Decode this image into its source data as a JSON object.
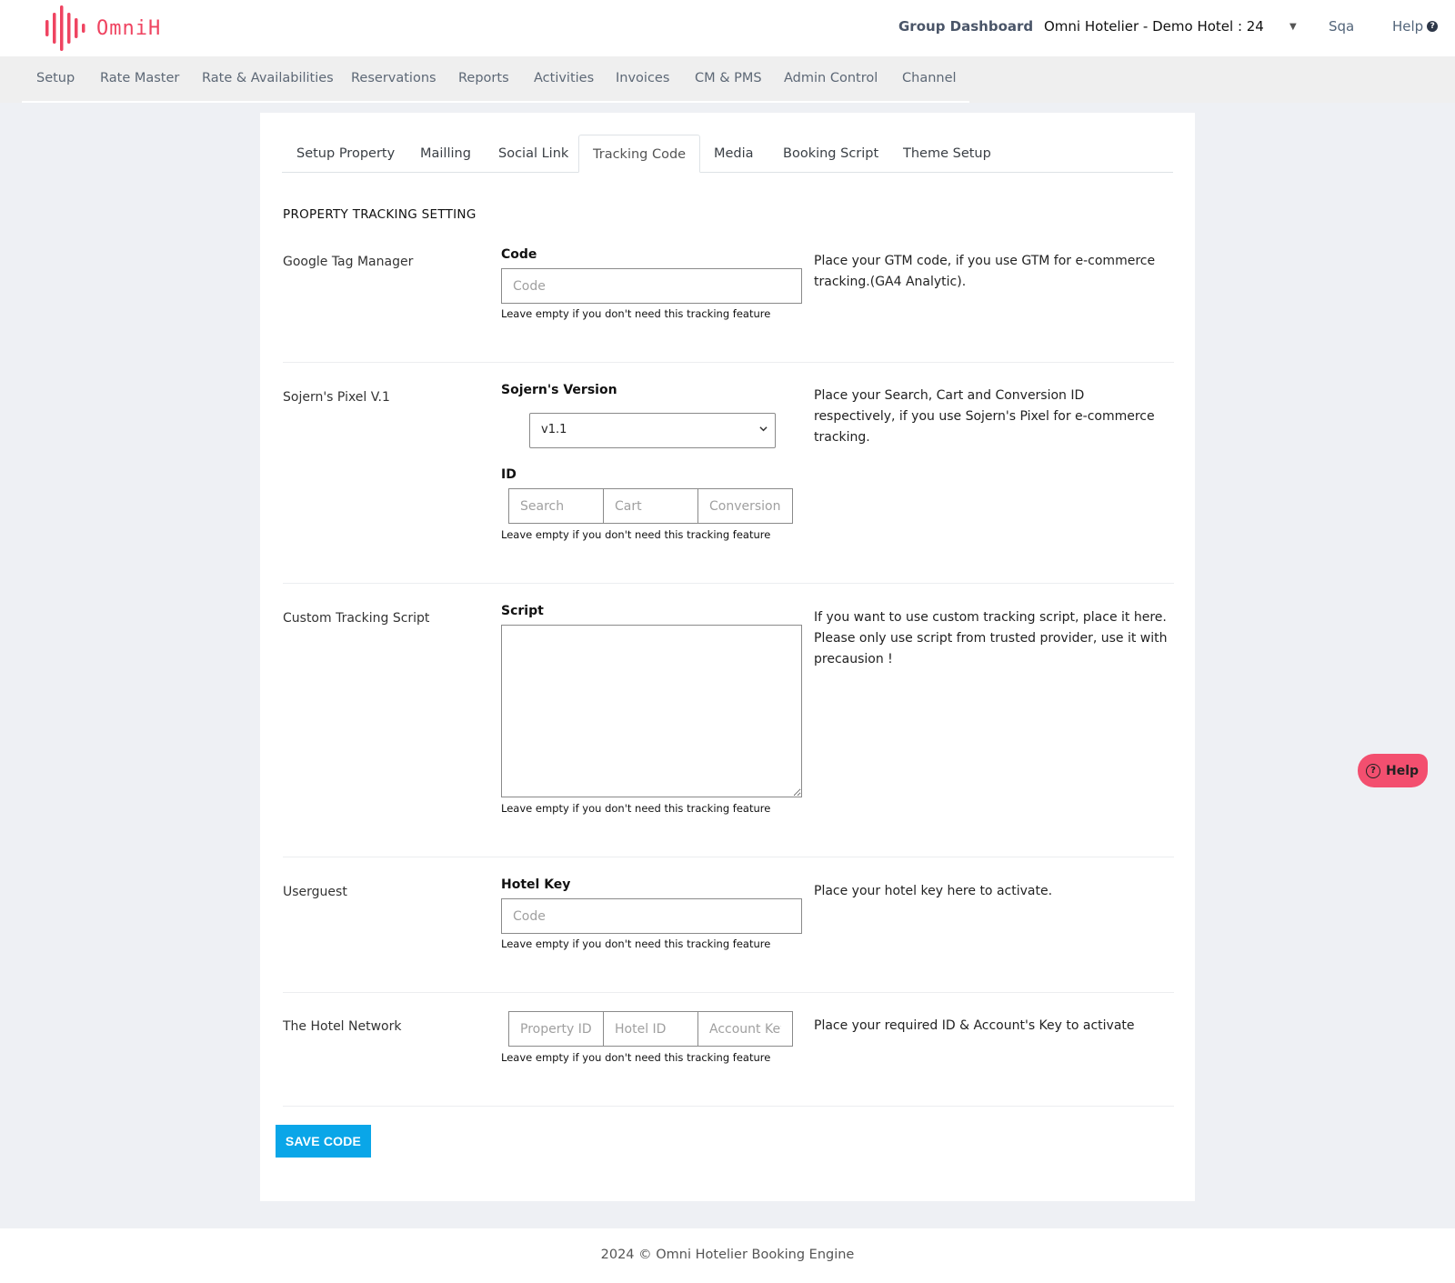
{
  "brand": {
    "name": "OmniH",
    "color": "#ef4461"
  },
  "header": {
    "group_dashboard": "Group Dashboard",
    "hotel_selector": "Omni Hotelier - Demo Hotel : 24",
    "user": "Sqa",
    "help": "Help"
  },
  "nav": {
    "items": [
      {
        "label": "Setup"
      },
      {
        "label": "Rate Master"
      },
      {
        "label": "Rate & Availabilities"
      },
      {
        "label": "Reservations"
      },
      {
        "label": "Reports"
      },
      {
        "label": "Activities"
      },
      {
        "label": "Invoices"
      },
      {
        "label": "CM & PMS"
      },
      {
        "label": "Admin Control"
      },
      {
        "label": "Channel"
      }
    ]
  },
  "tabs": {
    "items": [
      {
        "label": "Setup Property"
      },
      {
        "label": "Mailling"
      },
      {
        "label": "Social Link"
      },
      {
        "label": "Tracking Code"
      },
      {
        "label": "Media"
      },
      {
        "label": "Booking Script"
      },
      {
        "label": "Theme Setup"
      }
    ],
    "active": "Tracking Code"
  },
  "section_title": "PROPERTY TRACKING SETTING",
  "hint": "Leave empty if you don't need this tracking feature",
  "gtm": {
    "label": "Google Tag Manager",
    "field_label": "Code",
    "placeholder": "Code",
    "value": "",
    "description": "Place your GTM code, if you use GTM for e-commerce tracking.(GA4 Analytic)."
  },
  "sojern": {
    "label": "Sojern's Pixel V.1",
    "version_label": "Sojern's Version",
    "version_value": "v1.1",
    "id_label": "ID",
    "placeholders": {
      "search": "Search",
      "cart": "Cart",
      "conversion": "Conversion"
    },
    "description": "Place your Search, Cart and Conversion ID respectively, if you use Sojern's Pixel for e-commerce tracking."
  },
  "custom_script": {
    "label": "Custom Tracking Script",
    "field_label": "Script",
    "value": "",
    "description": "If you want to use custom tracking script, place it here. Please only use script from trusted provider, use it with precausion !"
  },
  "userguest": {
    "label": "Userguest",
    "field_label": "Hotel Key",
    "placeholder": "Code",
    "value": "",
    "description": "Place your hotel key here to activate."
  },
  "hotel_network": {
    "label": "The Hotel Network",
    "placeholders": {
      "property_id": "Property ID",
      "hotel_id": "Hotel ID",
      "account_key": "Account Key"
    },
    "description": "Place your required ID & Account's Key to activate"
  },
  "save_button": "SAVE CODE",
  "float_help": "Help",
  "footer": "2024 © Omni Hotelier Booking Engine",
  "colors": {
    "save_button": "#0aa6e8",
    "float_help": "#f34f6f",
    "page_bg": "#eef0f4"
  }
}
